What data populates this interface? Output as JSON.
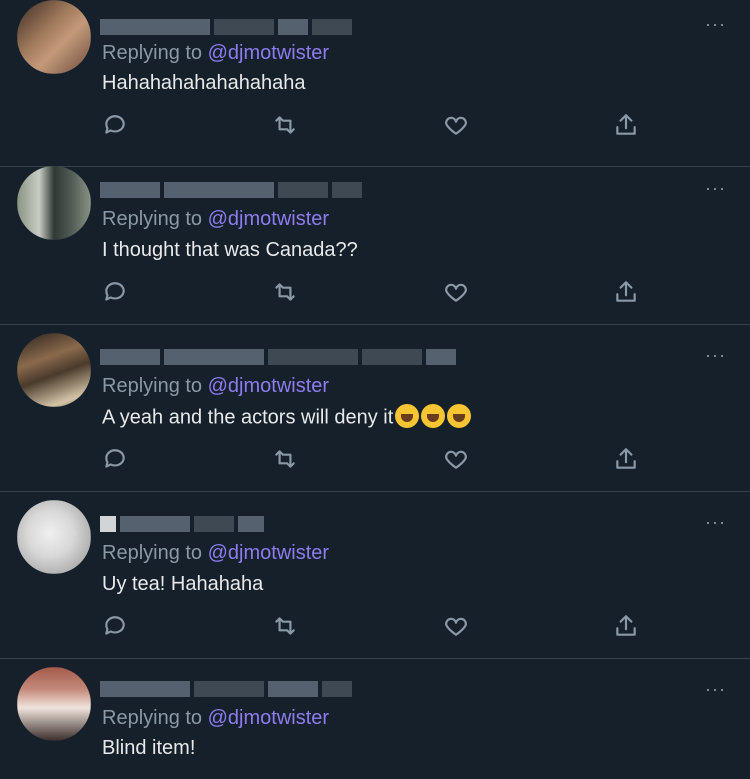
{
  "replying_label": "Replying to",
  "more_label": "···",
  "replies": [
    {
      "handle": "@djmotwister",
      "text": "Hahahahahahahahaha",
      "avatar_colors": [
        "#6b4a3a",
        "#a07a5c",
        "#3a2a22",
        "#c49a7a"
      ]
    },
    {
      "handle": "@djmotwister",
      "text": "I thought that was Canada??",
      "avatar_colors": [
        "#8a9484",
        "#2f3a34",
        "#c8ccc4",
        "#555e58"
      ]
    },
    {
      "handle": "@djmotwister",
      "text": "A yeah and the actors will deny it",
      "emoji": "rolling-on-floor-laughing",
      "emoji_count": 3,
      "avatar_colors": [
        "#4a3a2c",
        "#8a6a4c",
        "#d4c4a8",
        "#2a221c"
      ]
    },
    {
      "handle": "@djmotwister",
      "text": "Uy tea! Hahahaha",
      "avatar_colors": [
        "#d8d8d8",
        "#b4b4b4",
        "#f0f0f0",
        "#9a9a9a"
      ]
    },
    {
      "handle": "@djmotwister",
      "text": "Blind item!",
      "avatar_colors": [
        "#a45a4a",
        "#f0e4dc",
        "#3a2c2a",
        "#c48a7a"
      ]
    }
  ],
  "colors": {
    "background": "#15202b",
    "accent": "#8c7cf0",
    "muted": "#8b98a5",
    "divider": "#38444d"
  }
}
